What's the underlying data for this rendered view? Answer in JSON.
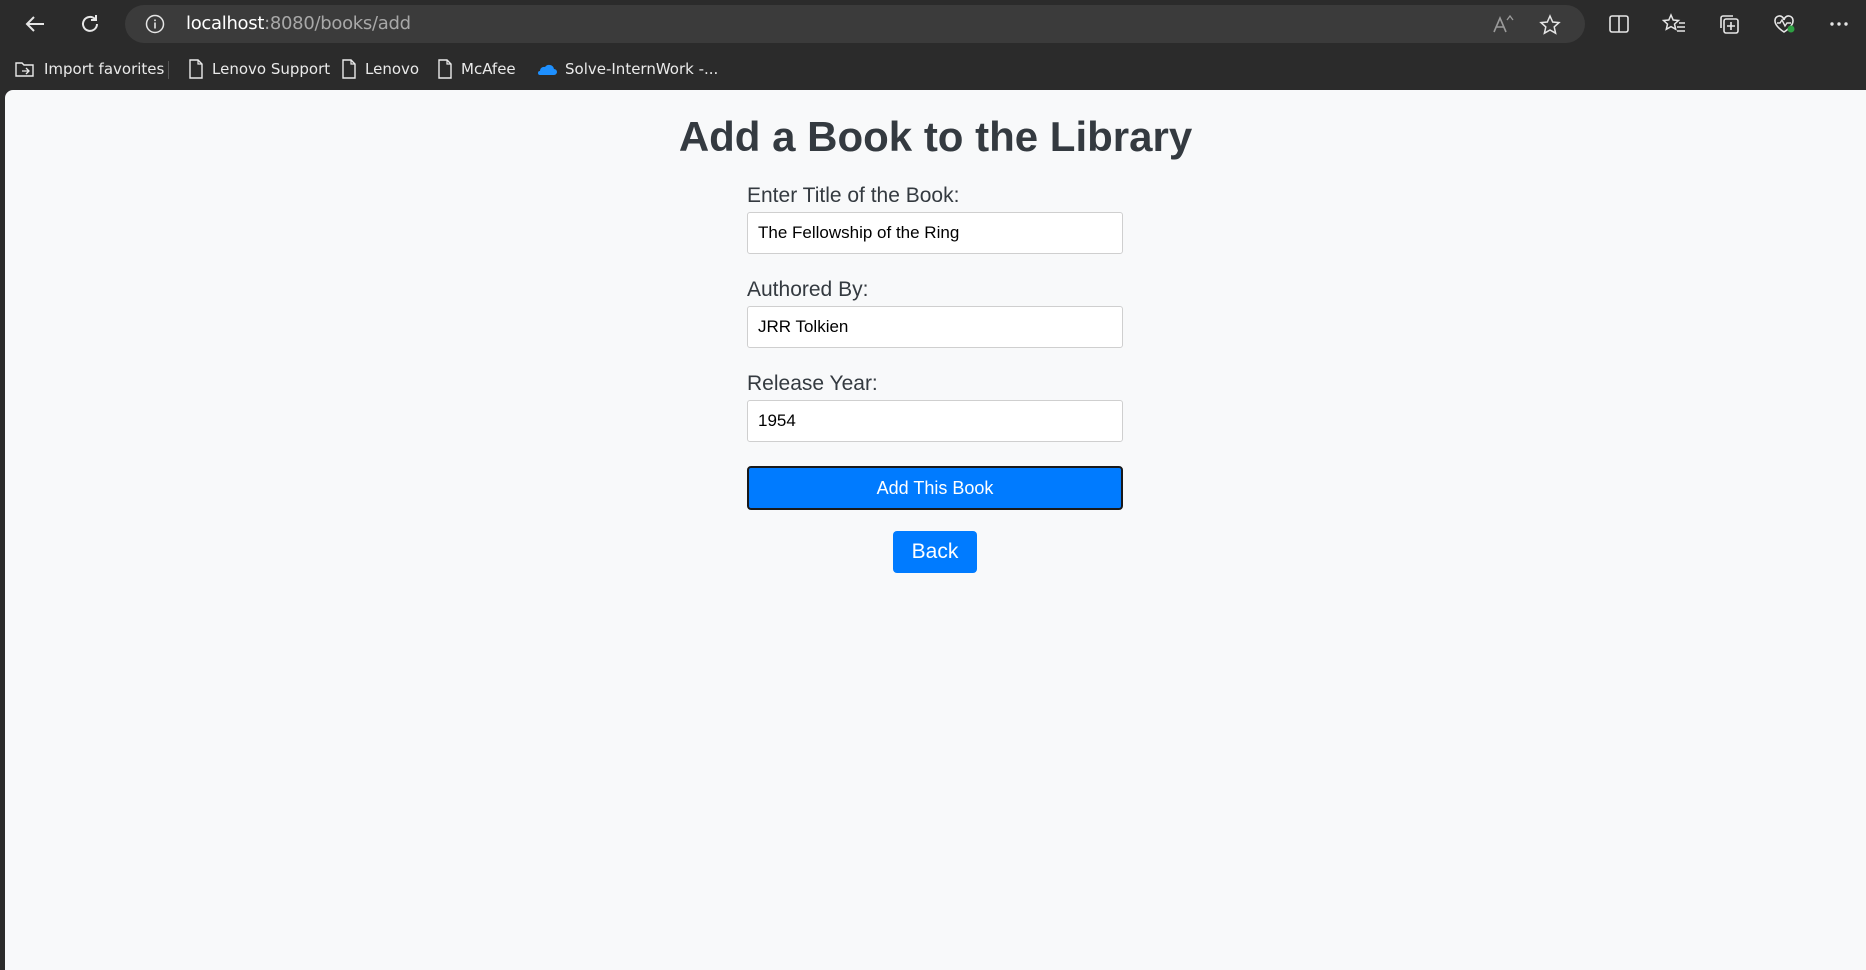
{
  "browser": {
    "url_host": "localhost",
    "url_path": ":8080/books/add",
    "bookmarks": [
      {
        "label": "Import favorites",
        "icon": "import-icon"
      },
      {
        "label": "Lenovo Support",
        "icon": "page-icon"
      },
      {
        "label": "Lenovo",
        "icon": "page-icon"
      },
      {
        "label": "McAfee",
        "icon": "page-icon"
      },
      {
        "label": "Solve-InternWork -...",
        "icon": "onedrive-icon"
      }
    ],
    "colors": {
      "chrome": "#2b2b2b",
      "address_bar": "#3b3b3b"
    }
  },
  "page": {
    "title": "Add a Book to the Library",
    "form": {
      "title_label": "Enter Title of the Book:",
      "title_value": "The Fellowship of the Ring",
      "author_label": "Authored By:",
      "author_value": "JRR Tolkien",
      "year_label": "Release Year:",
      "year_value": "1954",
      "submit_label": "Add This Book"
    },
    "back_label": "Back",
    "colors": {
      "background": "#f8f9fa",
      "primary": "#007bff",
      "text": "#343a40"
    }
  }
}
